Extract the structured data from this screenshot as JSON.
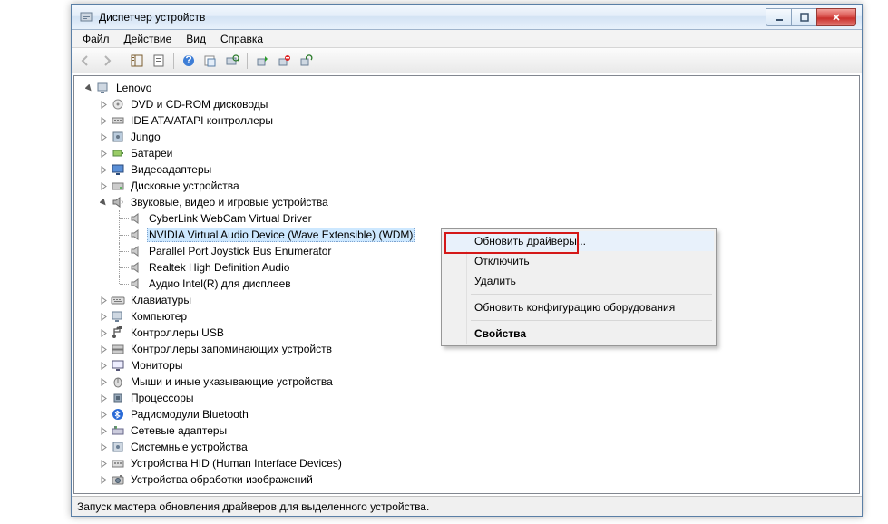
{
  "window": {
    "title": "Диспетчер устройств"
  },
  "menubar": [
    "Файл",
    "Действие",
    "Вид",
    "Справка"
  ],
  "tree": {
    "root": {
      "label": "Lenovo",
      "expanded": true
    },
    "children": [
      {
        "label": "DVD и CD-ROM дисководы",
        "icon": "cd"
      },
      {
        "label": "IDE ATA/ATAPI контроллеры",
        "icon": "ide"
      },
      {
        "label": "Jungo",
        "icon": "jungo"
      },
      {
        "label": "Батареи",
        "icon": "battery"
      },
      {
        "label": "Видеоадаптеры",
        "icon": "display"
      },
      {
        "label": "Дисковые устройства",
        "icon": "disk"
      },
      {
        "label": "Звуковые, видео и игровые устройства",
        "icon": "sound",
        "expanded": true,
        "children": [
          {
            "label": "CyberLink WebCam Virtual Driver",
            "icon": "speaker"
          },
          {
            "label": "NVIDIA Virtual Audio Device (Wave Extensible) (WDM)",
            "icon": "speaker",
            "selected": true
          },
          {
            "label": "Parallel Port Joystick Bus Enumerator",
            "icon": "speaker"
          },
          {
            "label": "Realtek High Definition Audio",
            "icon": "speaker"
          },
          {
            "label": "Аудио Intel(R) для дисплеев",
            "icon": "speaker"
          }
        ]
      },
      {
        "label": "Клавиатуры",
        "icon": "keyboard"
      },
      {
        "label": "Компьютер",
        "icon": "computer"
      },
      {
        "label": "Контроллеры USB",
        "icon": "usb"
      },
      {
        "label": "Контроллеры запоминающих устройств",
        "icon": "storage"
      },
      {
        "label": "Мониторы",
        "icon": "monitor"
      },
      {
        "label": "Мыши и иные указывающие устройства",
        "icon": "mouse"
      },
      {
        "label": "Процессоры",
        "icon": "cpu"
      },
      {
        "label": "Радиомодули Bluetooth",
        "icon": "bt"
      },
      {
        "label": "Сетевые адаптеры",
        "icon": "net"
      },
      {
        "label": "Системные устройства",
        "icon": "system"
      },
      {
        "label": "Устройства HID (Human Interface Devices)",
        "icon": "hid"
      },
      {
        "label": "Устройства обработки изображений",
        "icon": "imaging"
      }
    ]
  },
  "context_menu": {
    "items": [
      {
        "label": "Обновить драйверы...",
        "highlighted": true
      },
      {
        "label": "Отключить"
      },
      {
        "label": "Удалить"
      },
      {
        "sep": true
      },
      {
        "label": "Обновить конфигурацию оборудования"
      },
      {
        "sep": true
      },
      {
        "label": "Свойства",
        "bold": true
      }
    ]
  },
  "statusbar": "Запуск мастера обновления драйверов для выделенного устройства."
}
